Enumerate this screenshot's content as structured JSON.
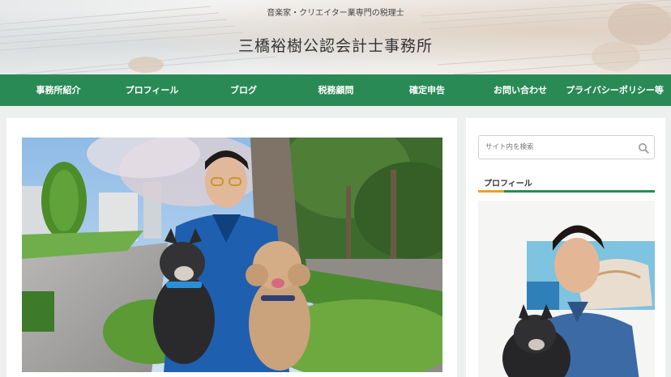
{
  "header": {
    "tagline": "音楽家・クリエイター業専門の税理士",
    "site_title": "三橋裕樹公認会計士事務所"
  },
  "nav": {
    "items": [
      {
        "label": "事務所紹介"
      },
      {
        "label": "プロフィール"
      },
      {
        "label": "ブログ"
      },
      {
        "label": "税務顧問"
      },
      {
        "label": "確定申告"
      },
      {
        "label": "お問い合わせ"
      },
      {
        "label": "プライバシーポリシー等"
      }
    ]
  },
  "sidebar": {
    "search_placeholder": "サイト内を検索",
    "profile_title": "プロフィール"
  },
  "colors": {
    "nav_bg": "#2a8a56",
    "accent_orange": "#e6a12c"
  }
}
